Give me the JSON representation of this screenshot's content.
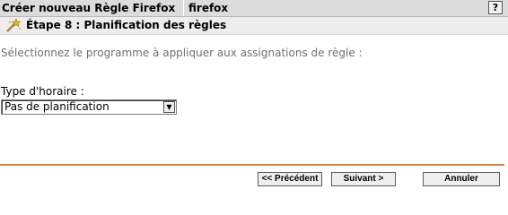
{
  "titlebar": {
    "title": "Créer nouveau Règle Firefox",
    "object_name": "firefox",
    "help_label": "?"
  },
  "step": {
    "title": "Étape 8 : Planification des règles",
    "icon": "wizard-wand-icon"
  },
  "form": {
    "instruction": "Sélectionnez le programme à appliquer aux assignations de règle :",
    "schedule_type_label": "Type d'horaire :",
    "schedule_type_value": "Pas de planification"
  },
  "buttons": {
    "previous": "<< Précédent",
    "next": "Suivant >",
    "cancel": "Annuler"
  },
  "colors": {
    "divider": "#d0804c",
    "titlebar_bg": "#dcdcdc",
    "stepbar_bg": "#ededed"
  }
}
